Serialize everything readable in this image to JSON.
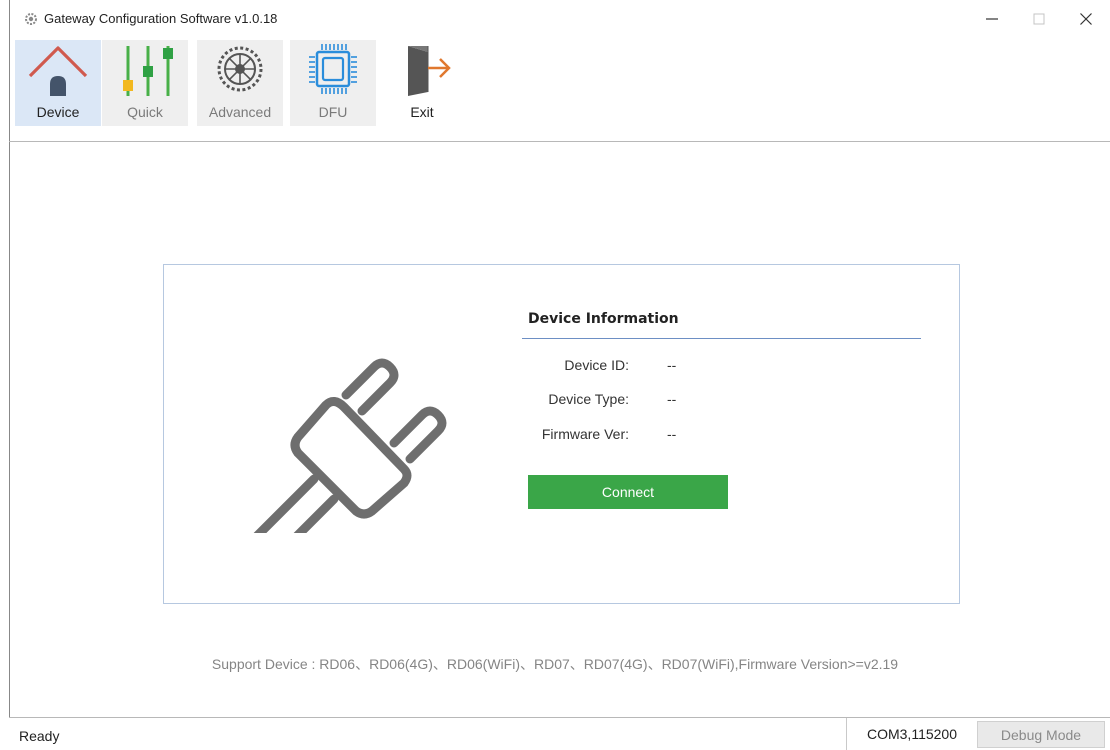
{
  "window": {
    "title": "Gateway Configuration Software v1.0.18"
  },
  "toolbar": {
    "items": [
      {
        "label": "Device",
        "icon": "house-icon",
        "active": true
      },
      {
        "label": "Quick",
        "icon": "sliders-icon",
        "active": false
      },
      {
        "label": "Advanced",
        "icon": "gear-icon",
        "active": false
      },
      {
        "label": "DFU",
        "icon": "chip-icon",
        "active": false
      },
      {
        "label": "Exit",
        "icon": "exit-door-icon",
        "active": false
      }
    ]
  },
  "device_info": {
    "title": "Device Information",
    "rows": [
      {
        "label": "Device ID:",
        "value": "--"
      },
      {
        "label": "Device Type:",
        "value": "--"
      },
      {
        "label": "Firmware Ver:",
        "value": "--"
      }
    ],
    "connect_label": "Connect"
  },
  "support_text": "Support Device : RD06、RD06(4G)、RD06(WiFi)、RD07、RD07(4G)、RD07(WiFi),Firmware Version>=v2.19",
  "statusbar": {
    "status": "Ready",
    "port": "COM3,115200",
    "debug_label": "Debug Mode"
  },
  "colors": {
    "accent_active_tab": "#dbe7f6",
    "connect_button": "#3aa648",
    "card_border": "#b6c8e0",
    "info_underline": "#6d8fc4"
  }
}
